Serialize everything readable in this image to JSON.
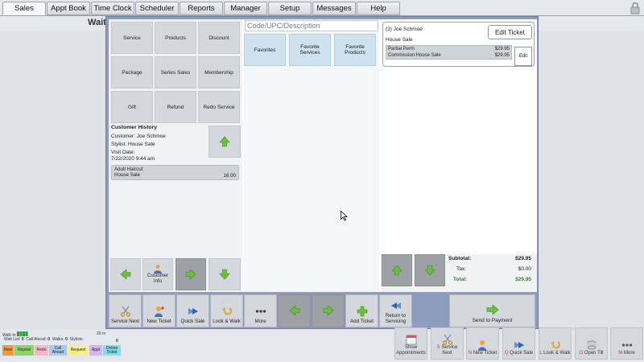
{
  "tabs": [
    {
      "label": "Sales",
      "active": true
    },
    {
      "label": "Appt Book"
    },
    {
      "label": "Time Clock"
    },
    {
      "label": "Scheduler"
    },
    {
      "label": "Reports"
    },
    {
      "label": "Manager"
    },
    {
      "label": "Setup"
    },
    {
      "label": "Messages"
    },
    {
      "label": "Help"
    }
  ],
  "background_title": "Wait",
  "categories": [
    "Service",
    "Products",
    "Discount",
    "Package",
    "Series Sales",
    "Membership",
    "Gift",
    "Refund",
    "Redo Service"
  ],
  "customer_history": {
    "title": "Customer History",
    "customer": "Customer: Joe Schmoe",
    "stylist": "Stylist: House Sale",
    "visit_date_label": "Visit Date:",
    "visit_date": "7/22/2020 9:44 am",
    "item_name": "Adult Haircut",
    "item_stylist": "House Sale",
    "item_price": "16.00"
  },
  "customer_info_label": "Customer Info",
  "search": {
    "placeholder": "Code/UPC/Description"
  },
  "favorites": [
    "Favorites",
    "Favorite Services",
    "Favorite Products"
  ],
  "ticket": {
    "title": "(3) Joe Schmoe",
    "stylist": "House Sale",
    "edit_label": "Edit Ticket",
    "item_name": "Partial Perm",
    "item_price": "$29.95",
    "item_commission": "Commission:House Sale",
    "item_commission_price": "$29.95",
    "item_edit_label": "Edit"
  },
  "totals": {
    "subtotal_label": "Subtotal:",
    "subtotal": "$29.95",
    "tax_label": "Tax:",
    "tax": "$0.00",
    "total_label": "Total:",
    "total": "$29.95"
  },
  "bottom_buttons": {
    "service_next": "Service Next",
    "new_ticket": "New Ticket",
    "quick_sale": "Quick Sale",
    "look_walk": "Look & Walk",
    "more": "More",
    "add_ticket": "Add Ticket",
    "return_servicing": "Return to Servicing",
    "send_payment": "Send to Payment"
  },
  "status": {
    "walk_in": "Walk In",
    "wait_list_label": "Wait List:",
    "wait_list": "0",
    "call_ahead_label": "Call Ahead:",
    "call_ahead": "0",
    "walks_label": "Walks:",
    "walks": "0",
    "stylists_label": "Stylists:",
    "minutes": "20 m",
    "count": "0",
    "chips": [
      "New",
      "Repeat",
      "Redo",
      "Call Ahead",
      "Request",
      "Appt",
      "Online Ticket"
    ]
  },
  "action_bar": {
    "show_appointments": "Show Appointments",
    "service_next": {
      "key": "S",
      "label": "Service Next"
    },
    "new_ticket": {
      "key": "N",
      "label": "New Ticket"
    },
    "quick_sale": {
      "key": "Q",
      "label": "Quick Sale"
    },
    "look_walk": {
      "key": "L",
      "label": "Look & Walk"
    },
    "open_till": {
      "key": "O",
      "label": "Open Till"
    },
    "more": {
      "key": "M",
      "label": "More"
    }
  },
  "colors": {
    "modal_frame": "#8d9bbf",
    "favorite_blue": "#cfe0ef",
    "arrow_green": "#6bbf3a",
    "total_green": "#2e8b2e",
    "hotkey_red": "#d03a2a"
  }
}
